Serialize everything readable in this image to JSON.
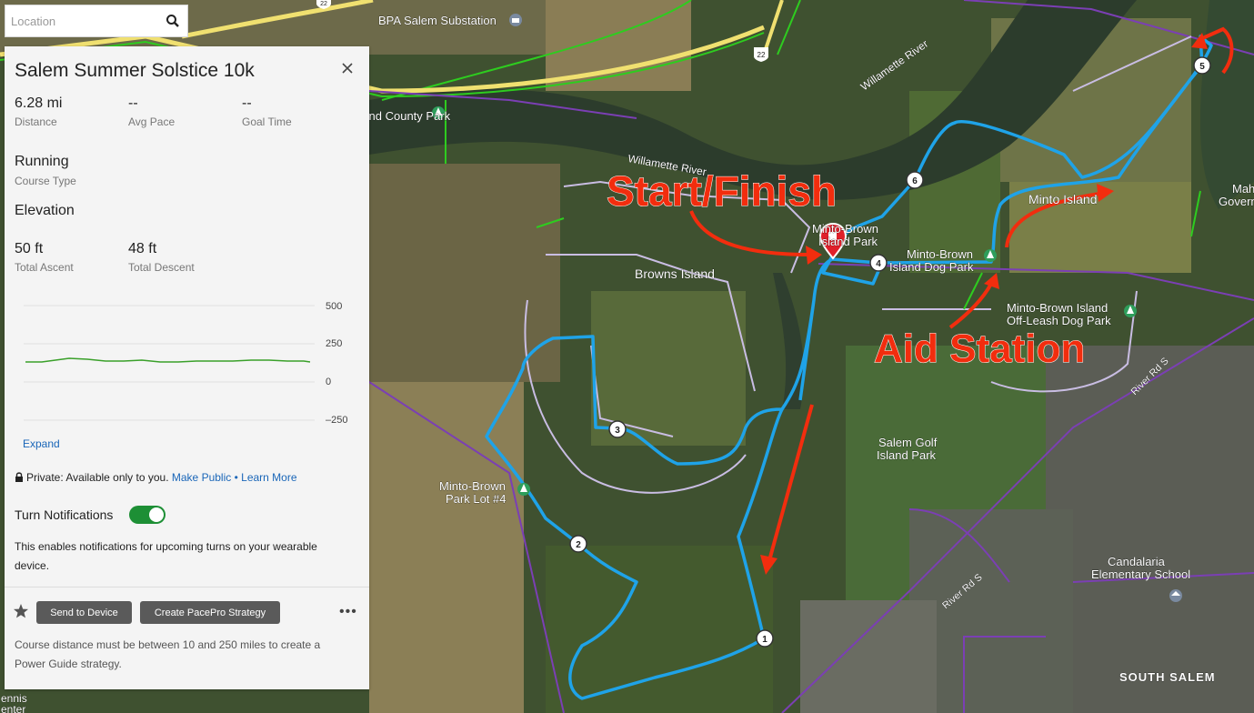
{
  "search": {
    "placeholder": "Location"
  },
  "panel": {
    "title": "Salem Summer Solstice 10k",
    "stats": [
      {
        "value": "6.28 mi",
        "label": "Distance"
      },
      {
        "value": "--",
        "label": "Avg Pace"
      },
      {
        "value": "--",
        "label": "Goal Time"
      }
    ],
    "course_type": {
      "value": "Running",
      "label": "Course Type"
    },
    "elevation": {
      "heading": "Elevation",
      "ascent": {
        "value": "50 ft",
        "label": "Total Ascent"
      },
      "descent": {
        "value": "48 ft",
        "label": "Total Descent"
      }
    },
    "chart": {
      "y_ticks": [
        "500",
        "250",
        "0",
        "–250"
      ],
      "expand_label": "Expand"
    },
    "privacy": {
      "text": "Private: Available only to you.",
      "make_public": "Make Public",
      "separator": "•",
      "learn_more": "Learn More"
    },
    "notifications": {
      "label": "Turn Notifications",
      "enabled": true,
      "description": "This enables notifications for upcoming turns on your wearable device."
    },
    "actions": {
      "send_to_device": "Send to Device",
      "pacepro": "Create PacePro Strategy",
      "more": "•••"
    },
    "footer": "Course distance must be between 10 and 250 miles to create a Power Guide strategy."
  },
  "map": {
    "labels": {
      "bpa": "BPA Salem Substation",
      "willamette_river": "Willamette River",
      "willamette_river_2": "Willamette River",
      "county_park": "Sole Bend County Park",
      "browns_island": "Browns Island",
      "minto_brown": "Minto-Brown",
      "island_park": "Island Park",
      "dog_park_1": "Minto-Brown",
      "dog_park_2": "Island Dog Park",
      "minto_island": "Minto Island",
      "offleash_1": "Minto-Brown Island",
      "offleash_2": "Off-Leash Dog Park",
      "golf_1": "Salem Golf",
      "golf_2": "Island Park",
      "lot_1": "Minto-Brown",
      "lot_2": "Park Lot #4",
      "candalaria_1": "Candalaria",
      "candalaria_2": "Elementary School",
      "south_salem": "SOUTH SALEM",
      "river_rd_1": "River Rd S",
      "river_rd_2": "River Rd S",
      "governor_1": "Mah",
      "governor_2": "Governor's",
      "hwy": "22",
      "hwy2": "22",
      "tennis_1": "ennis",
      "tennis_2": "enter"
    },
    "annotations": {
      "start_finish": "Start/Finish",
      "aid_station": "Aid Station"
    },
    "waypoints": [
      "1",
      "2",
      "3",
      "4",
      "5",
      "6"
    ],
    "colors": {
      "route": "#1fa3e8",
      "annotation": "#f22d0e",
      "trail_purple": "#7b3fb4",
      "trail_green": "#2ecc1f",
      "toggle_on": "#1d8f35"
    }
  }
}
